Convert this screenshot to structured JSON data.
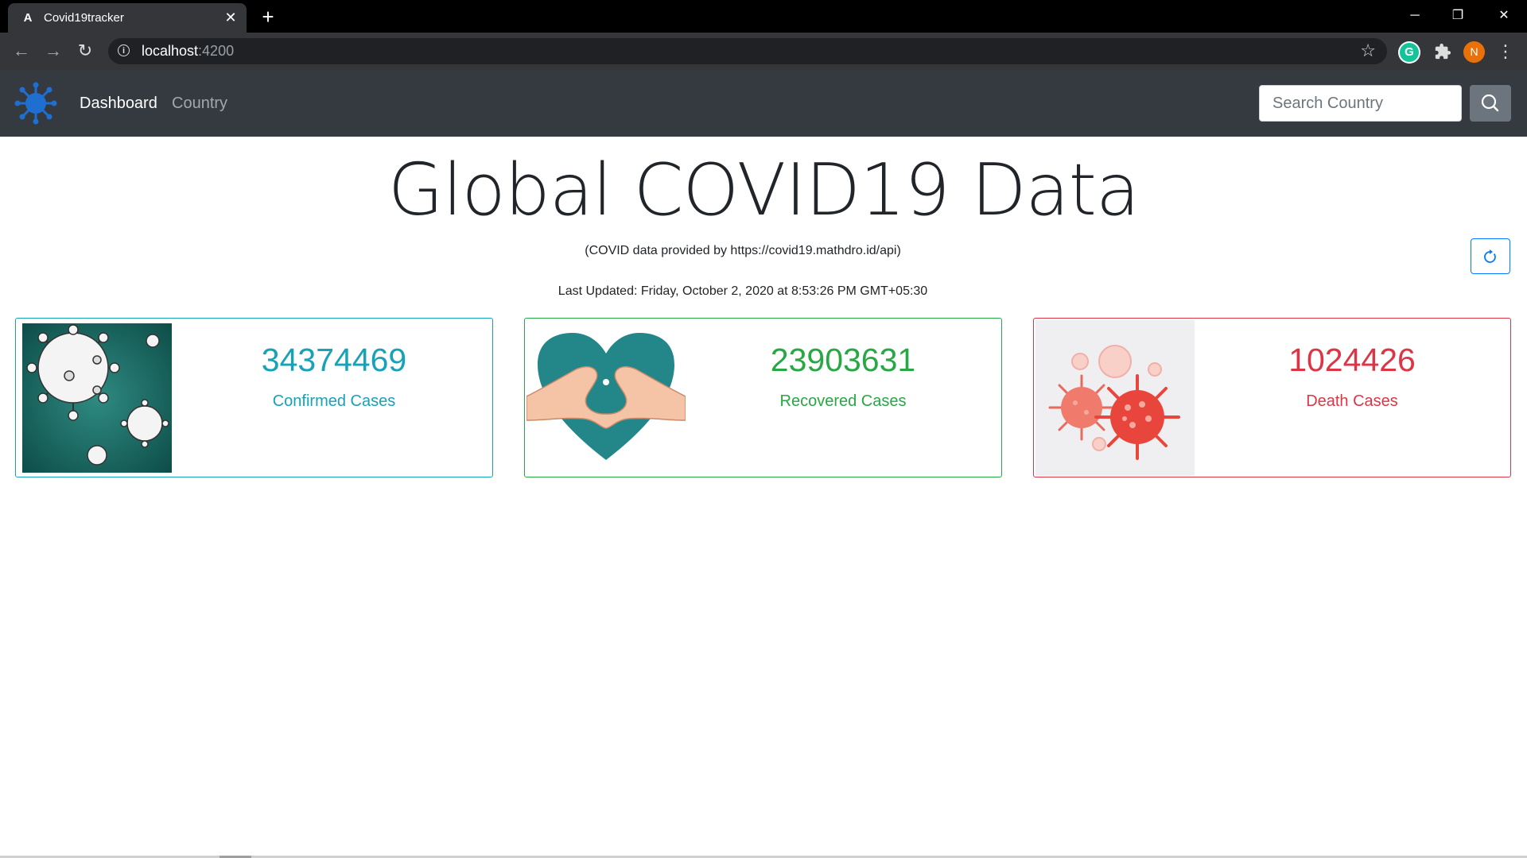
{
  "browser": {
    "tab": {
      "favicon": "A",
      "title": "Covid19tracker",
      "close": "✕"
    },
    "new_tab": "+",
    "window_controls": {
      "minimize": "─",
      "restore": "❐",
      "close": "✕"
    },
    "nav": {
      "back": "←",
      "forward": "→",
      "reload": "↻"
    },
    "url": {
      "host": "localhost",
      "port": ":4200"
    },
    "star": "☆",
    "extension_letter": "G",
    "puzzle": "✱",
    "avatar_letter": "N",
    "menu": "⋮"
  },
  "navbar": {
    "brand_icon": "virus-icon",
    "links": [
      {
        "label": "Dashboard",
        "active": true
      },
      {
        "label": "Country",
        "active": false
      }
    ],
    "search": {
      "placeholder": "Search Country",
      "value": ""
    },
    "search_icon": "search-icon"
  },
  "main": {
    "title": "Global COVID19 Data",
    "source": "(COVID data provided by https://covid19.mathdro.id/api)",
    "refresh_icon": "refresh-icon",
    "last_updated": "Last Updated: Friday, October 2, 2020 at 8:53:26 PM GMT+05:30",
    "cards": [
      {
        "value": "34374469",
        "label": "Confirmed Cases",
        "color": "#17a2b8",
        "image": "virus-illustration"
      },
      {
        "value": "23903631",
        "label": "Recovered Cases",
        "color": "#28a745",
        "image": "heart-hands-illustration"
      },
      {
        "value": "1024426",
        "label": "Death Cases",
        "color": "#dc3545",
        "image": "red-virus-illustration"
      }
    ]
  }
}
